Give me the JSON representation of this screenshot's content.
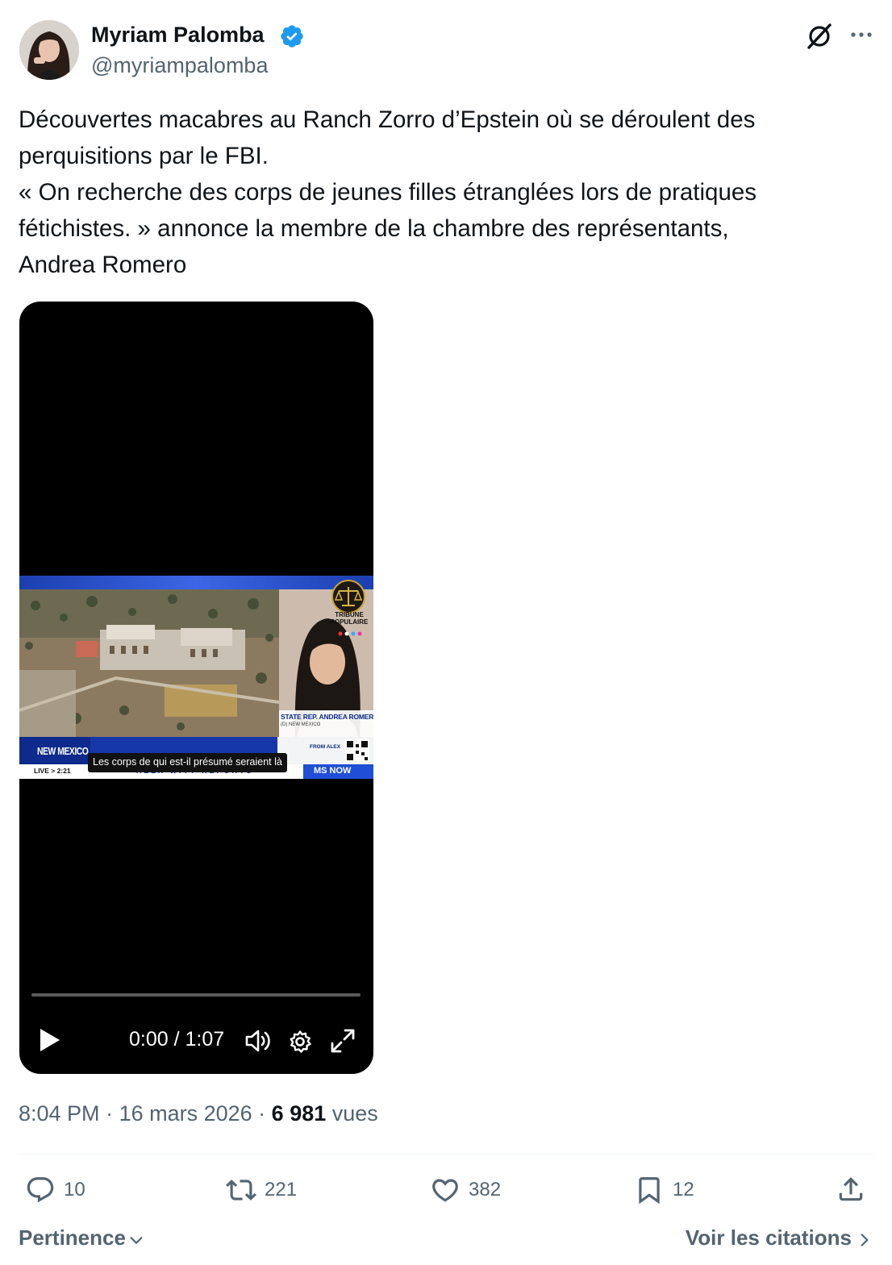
{
  "author": {
    "display_name": "Myriam Palomba",
    "handle": "@myriampalomba",
    "verified": true,
    "verified_color": "#1d9bf0"
  },
  "tweet": {
    "lines": [
      "Découvertes macabres au Ranch Zorro d’Epstein où se déroulent des",
      "perquisitions par le FBI.",
      "« On recherche des corps de jeunes filles étranglées lors de pratiques",
      "fétichistes. » annonce la membre de la chambre des représentants,",
      "Andrea Romero"
    ]
  },
  "video": {
    "subtitle": "Les corps de qui est-il présumé seraient là",
    "time_display": "0:00 / 1:07",
    "progress": 0,
    "broadcast": {
      "state_tag": "NEW MEXICO",
      "guest_name": "STATE REP. ANDREA ROMERO",
      "guest_location": "(D) NEW MEXICO",
      "from_tag": "FROM ALEX",
      "live_tag": "LIVE > 2:21",
      "show_name": "ALEX WITT REPORTS",
      "network": "MS NOW",
      "channel_logo_line1": "TRIBUNE",
      "channel_logo_line2": "POPULAIRE"
    }
  },
  "meta": {
    "time": "8:04 PM",
    "date": "16 mars 2026",
    "views_count": "6 981",
    "views_label": "vues"
  },
  "actions": {
    "replies": "10",
    "reposts": "221",
    "likes": "382",
    "bookmarks": "12"
  },
  "footer": {
    "sort_label": "Pertinence",
    "quotes_label": "Voir les citations"
  },
  "icons": [
    "verified-badge-icon",
    "grok-icon",
    "more-icon",
    "play-icon",
    "volume-icon",
    "settings-icon",
    "fullscreen-icon",
    "reply-icon",
    "repost-icon",
    "like-icon",
    "bookmark-icon",
    "share-icon",
    "chevron-down-icon",
    "chevron-right-icon"
  ]
}
